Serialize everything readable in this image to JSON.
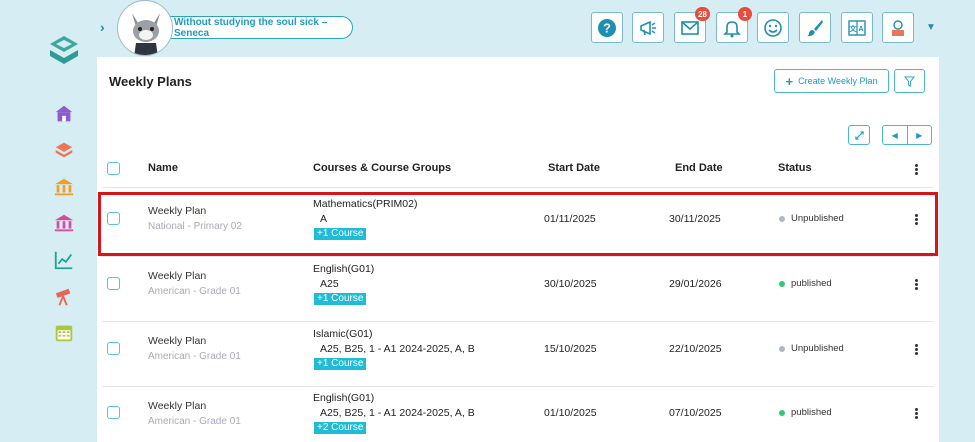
{
  "header": {
    "quote": "Without studying the soul sick – Seneca",
    "notifications": {
      "messages_count": "28",
      "alerts_count": "1"
    }
  },
  "page": {
    "title": "Weekly Plans",
    "create_button": "Create Weekly Plan"
  },
  "table": {
    "columns": {
      "name": "Name",
      "courses": "Courses & Course Groups",
      "start": "Start Date",
      "end": "End Date",
      "status": "Status"
    },
    "rows": [
      {
        "name": "Weekly Plan",
        "program": "National - Primary 02",
        "course": "Mathematics(PRIM02)",
        "groups": "A",
        "more": "+1 Course",
        "start": "01/11/2025",
        "end": "30/11/2025",
        "status": "Unpublished",
        "status_color": "#b0b8c8"
      },
      {
        "name": "Weekly Plan",
        "program": "American - Grade 01",
        "course": "English(G01)",
        "groups": "A25",
        "more": "+1 Course",
        "start": "30/10/2025",
        "end": "29/01/2026",
        "status": "published",
        "status_color": "#2ecc71"
      },
      {
        "name": "Weekly Plan",
        "program": "American - Grade 01",
        "course": "Islamic(G01)",
        "groups": "A25, B25, 1 - A1 2024-2025, A, B",
        "more": "+1 Course",
        "start": "15/10/2025",
        "end": "22/10/2025",
        "status": "Unpublished",
        "status_color": "#b0b8c8"
      },
      {
        "name": "Weekly Plan",
        "program": "American - Grade 01",
        "course": "English(G01)",
        "groups": "A25, B25, 1 - A1 2024-2025, A, B",
        "more": "+2 Course",
        "start": "01/10/2025",
        "end": "07/10/2025",
        "status": "published",
        "status_color": "#2ecc71"
      }
    ]
  },
  "colors": {
    "accent": "#1fbcd6",
    "highlight": "#d7141a",
    "background": "#d6eef3"
  }
}
